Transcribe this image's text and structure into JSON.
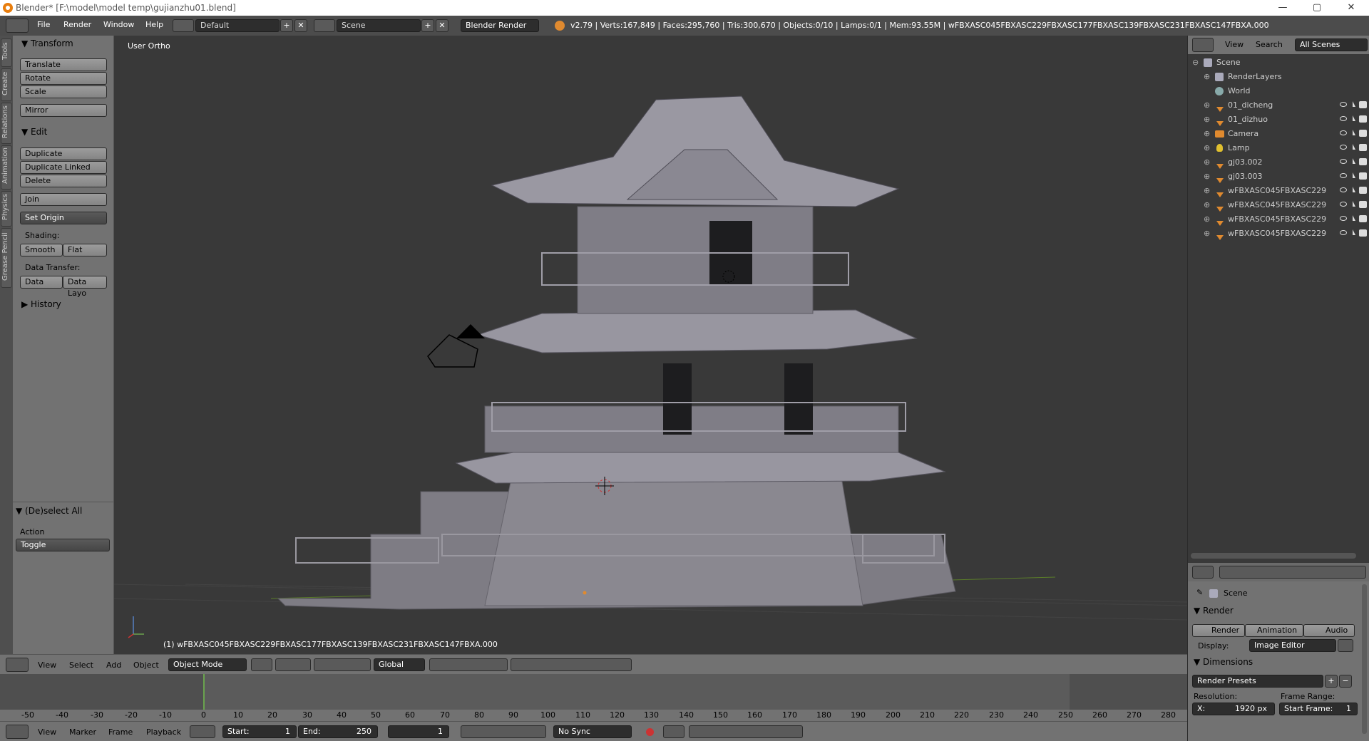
{
  "window": {
    "title": "Blender* [F:\\model\\model temp\\gujianzhu01.blend]",
    "minimize": "—",
    "maximize": "▢",
    "close": "✕"
  },
  "info_header": {
    "menus": [
      "File",
      "Render",
      "Window",
      "Help"
    ],
    "layout": "Default",
    "scene": "Scene",
    "engine": "Blender Render",
    "stats": "v2.79 | Verts:167,849 | Faces:295,760 | Tris:300,670 | Objects:0/10 | Lamps:0/1 | Mem:93.55M | wFBXASC045FBXASC229FBXASC177FBXASC139FBXASC231FBXASC147FBXA.000"
  },
  "tool_tabs": [
    "Tools",
    "Create",
    "Relations",
    "Animation",
    "Physics",
    "Grease Pencil"
  ],
  "toolshelf": {
    "transform": {
      "title": "Transform",
      "buttons": [
        "Translate",
        "Rotate",
        "Scale",
        "Mirror"
      ]
    },
    "edit": {
      "title": "Edit",
      "buttons": [
        "Duplicate",
        "Duplicate Linked",
        "Delete",
        "Join"
      ],
      "set_origin": "Set Origin",
      "shading_label": "Shading:",
      "smooth": "Smooth",
      "flat": "Flat",
      "data_transfer_label": "Data Transfer:",
      "data": "Data",
      "data_layout": "Data Layo"
    },
    "history": {
      "title": "History"
    },
    "operator": {
      "title": "(De)select All",
      "action_label": "Action",
      "action_value": "Toggle"
    }
  },
  "viewport": {
    "view_label": "User Ortho",
    "object_label": "(1) wFBXASC045FBXASC229FBXASC177FBXASC139FBXASC231FBXASC147FBXA.000"
  },
  "view3d_header": {
    "menus": [
      "View",
      "Select",
      "Add",
      "Object"
    ],
    "mode": "Object Mode",
    "orientation": "Global"
  },
  "timeline": {
    "ticks": [
      "-50",
      "-40",
      "-30",
      "-20",
      "-10",
      "0",
      "10",
      "20",
      "30",
      "40",
      "50",
      "60",
      "70",
      "80",
      "90",
      "100",
      "110",
      "120",
      "130",
      "140",
      "150",
      "160",
      "170",
      "180",
      "190",
      "200",
      "210",
      "220",
      "230",
      "240",
      "250",
      "260",
      "270",
      "280"
    ],
    "menus": [
      "View",
      "Marker",
      "Frame",
      "Playback"
    ],
    "start_label": "Start:",
    "start_value": "1",
    "end_label": "End:",
    "end_value": "250",
    "current_frame": "1",
    "sync": "No Sync"
  },
  "outliner": {
    "header": {
      "view": "View",
      "search": "Search",
      "filter": "All Scenes"
    },
    "rows": [
      {
        "name": "Scene",
        "indent": 0,
        "type": "scene"
      },
      {
        "name": "RenderLayers",
        "indent": 1,
        "type": "renderlayers"
      },
      {
        "name": "World",
        "indent": 1,
        "type": "world"
      },
      {
        "name": "01_dicheng",
        "indent": 1,
        "type": "mesh"
      },
      {
        "name": "01_dizhuo",
        "indent": 1,
        "type": "mesh"
      },
      {
        "name": "Camera",
        "indent": 1,
        "type": "camera"
      },
      {
        "name": "Lamp",
        "indent": 1,
        "type": "lamp"
      },
      {
        "name": "gj03.002",
        "indent": 1,
        "type": "mesh"
      },
      {
        "name": "gj03.003",
        "indent": 1,
        "type": "mesh"
      },
      {
        "name": "wFBXASC045FBXASC229",
        "indent": 1,
        "type": "mesh"
      },
      {
        "name": "wFBXASC045FBXASC229",
        "indent": 1,
        "type": "mesh"
      },
      {
        "name": "wFBXASC045FBXASC229",
        "indent": 1,
        "type": "mesh"
      },
      {
        "name": "wFBXASC045FBXASC229",
        "indent": 1,
        "type": "mesh"
      }
    ]
  },
  "properties": {
    "scene": "Scene",
    "render_panel": "Render",
    "render_btn": "Render",
    "animation_btn": "Animation",
    "audio_btn": "Audio",
    "display_label": "Display:",
    "display_value": "Image Editor",
    "dimensions_panel": "Dimensions",
    "render_presets": "Render Presets",
    "resolution_label": "Resolution:",
    "frame_range_label": "Frame Range:",
    "res_x": "X:",
    "res_x_value": "1920 px",
    "start_frame": "Start Frame:",
    "start_frame_value": "1"
  },
  "colors": {
    "accent_blue": "#5680c2",
    "mesh_orange": "#e08a2f",
    "viewport_bg": "#393939",
    "panel_bg": "#727272"
  }
}
